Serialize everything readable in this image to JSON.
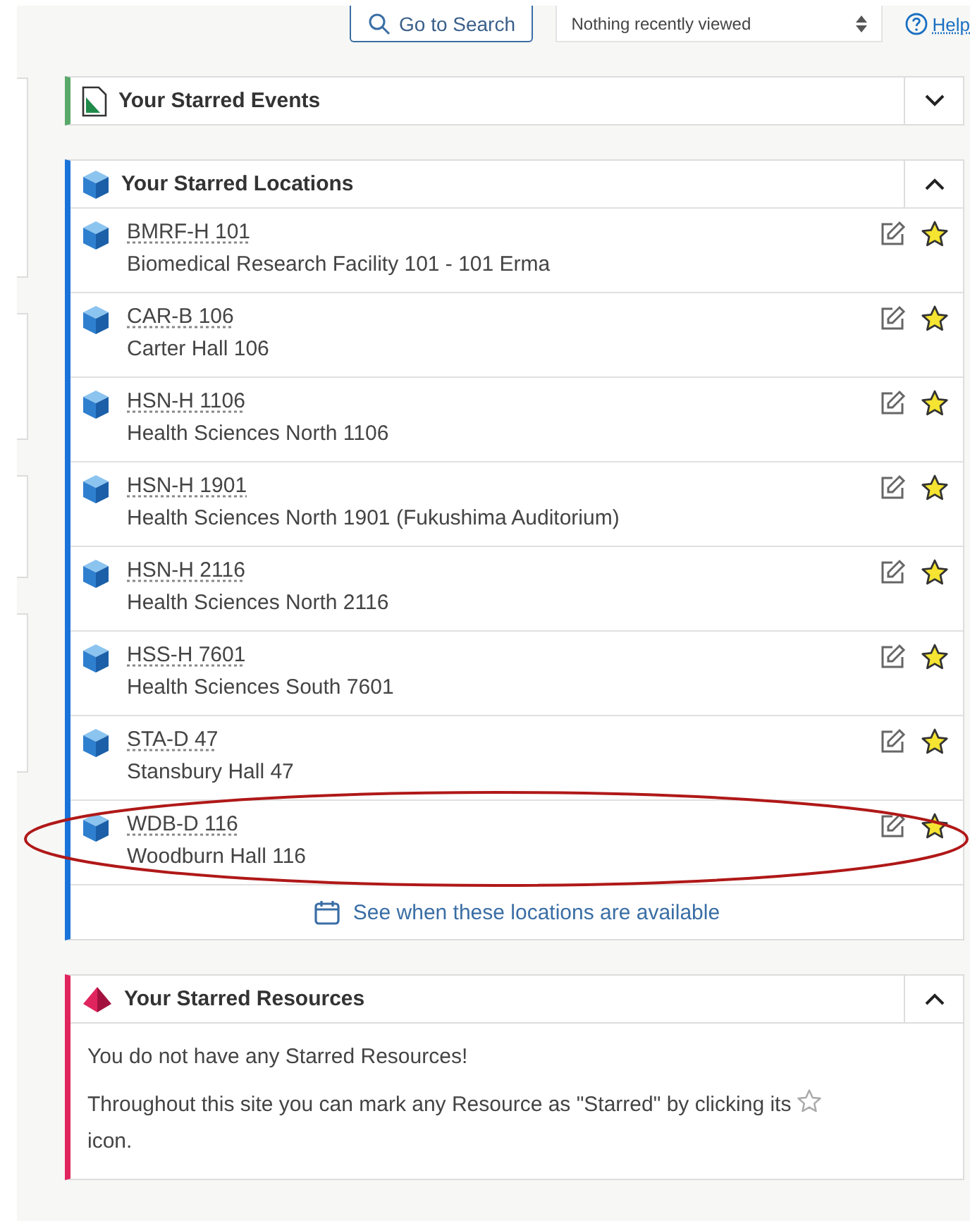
{
  "top_bar": {
    "search_button": "Go to Search",
    "recent_select": "Nothing recently viewed",
    "help_link": "Help"
  },
  "panels": [
    {
      "kind": "events",
      "title": "Your Starred Events",
      "color": "#5aa96b",
      "expanded": false
    },
    {
      "kind": "locations",
      "title": "Your Starred Locations",
      "color": "#1a73d9",
      "expanded": true,
      "items": [
        {
          "code": "BMRF-H 101",
          "name": "Biomedical Research Facility 101 - 101 Erma",
          "starred": true
        },
        {
          "code": "CAR-B 106",
          "name": "Carter Hall 106",
          "starred": true
        },
        {
          "code": "HSN-H 1106",
          "name": "Health Sciences North 1106",
          "starred": true
        },
        {
          "code": "HSN-H 1901",
          "name": "Health Sciences North 1901 (Fukushima Auditorium)",
          "starred": true
        },
        {
          "code": "HSN-H 2116",
          "name": "Health Sciences North 2116",
          "starred": true
        },
        {
          "code": "HSS-H 7601",
          "name": "Health Sciences South 7601",
          "starred": true
        },
        {
          "code": "STA-D 47",
          "name": "Stansbury Hall 47",
          "starred": true
        },
        {
          "code": "WDB-D 116",
          "name": "Woodburn Hall 116",
          "starred": true,
          "circled": true
        }
      ],
      "footer_link": "See when these locations are available"
    },
    {
      "kind": "resources",
      "title": "Your Starred Resources",
      "color": "#e0245e",
      "expanded": true,
      "empty_message": "You do not have any Starred Resources!",
      "hint_before_icon": "Throughout this site you can mark any Resource as \"Starred\" by clicking its",
      "hint_after_icon": "icon."
    }
  ]
}
